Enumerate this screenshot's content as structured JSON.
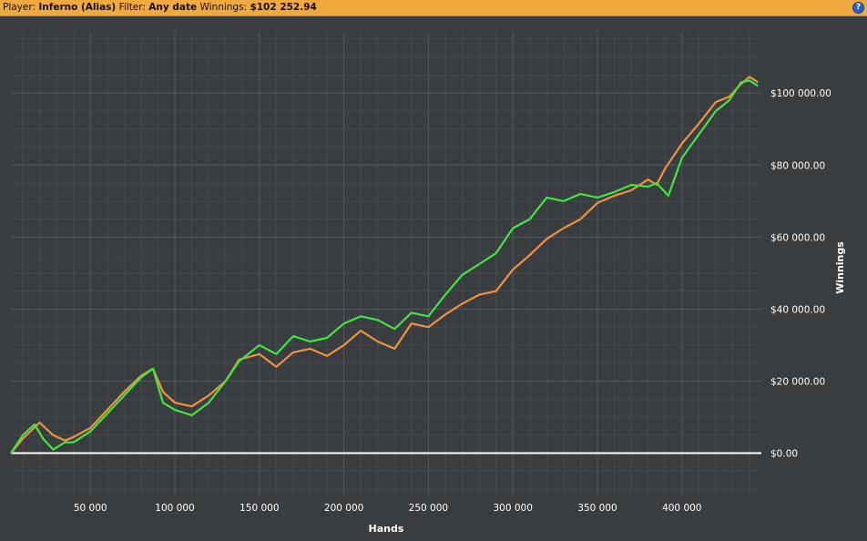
{
  "header": {
    "player_label": "Player:",
    "player_value": "Inferno (Alias)",
    "filter_label": "Filter:",
    "filter_value": "Any date",
    "winnings_label": "Winnings:",
    "winnings_value": "$102 252.94",
    "help_label": "?"
  },
  "colors": {
    "header_bg": "#f0a93f",
    "plot_bg": "#3a3d40",
    "grid": "#55595d",
    "series_green": "#3ee63e",
    "series_orange": "#f0913c",
    "zero_line": "#ffffff"
  },
  "chart_data": {
    "type": "line",
    "title": "",
    "xlabel": "Hands",
    "ylabel": "Winnings",
    "xlim": [
      3000,
      447000
    ],
    "ylim": [
      -12000,
      117000
    ],
    "x_ticks": [
      50000,
      100000,
      150000,
      200000,
      250000,
      300000,
      350000,
      400000
    ],
    "x_tick_labels": [
      "50 000",
      "100 000",
      "150 000",
      "200 000",
      "250 000",
      "300 000",
      "350 000",
      "400 000"
    ],
    "y_ticks": [
      0,
      20000,
      40000,
      60000,
      80000,
      100000
    ],
    "y_tick_labels": [
      "$0.00",
      "$20 000.00",
      "$40 000.00",
      "$60 000.00",
      "$80 000.00",
      "$100 000.00"
    ],
    "y_axis_side": "right",
    "grid": true,
    "legend": "none",
    "zero_line": true,
    "series": [
      {
        "color": "#f0913c",
        "x": [
          3000,
          10000,
          20000,
          28000,
          35000,
          40000,
          50000,
          60000,
          70000,
          80000,
          87000,
          93000,
          100000,
          110000,
          120000,
          130000,
          138000,
          150000,
          160000,
          170000,
          180000,
          190000,
          200000,
          210000,
          220000,
          230000,
          240000,
          250000,
          260000,
          270000,
          280000,
          290000,
          300000,
          310000,
          320000,
          330000,
          340000,
          350000,
          360000,
          370000,
          380000,
          385000,
          390000,
          400000,
          410000,
          420000,
          428000,
          435000,
          440000,
          445000
        ],
        "y": [
          0,
          4000,
          8500,
          5000,
          3500,
          4500,
          7000,
          12000,
          17000,
          21500,
          23500,
          17000,
          14000,
          13000,
          16000,
          20000,
          26000,
          27500,
          24000,
          28000,
          29000,
          27000,
          30000,
          34000,
          31000,
          29000,
          36000,
          35000,
          38500,
          41500,
          44000,
          45000,
          51000,
          55000,
          59500,
          62500,
          65000,
          69500,
          71500,
          73000,
          76000,
          74500,
          79000,
          86000,
          91500,
          97500,
          99000,
          102500,
          104500,
          103000
        ]
      },
      {
        "color": "#3ee63e",
        "x": [
          3000,
          10000,
          17000,
          22000,
          28000,
          35000,
          40000,
          50000,
          60000,
          70000,
          80000,
          87000,
          93000,
          100000,
          110000,
          120000,
          130000,
          138000,
          150000,
          160000,
          170000,
          180000,
          190000,
          200000,
          210000,
          220000,
          230000,
          240000,
          250000,
          260000,
          270000,
          280000,
          290000,
          300000,
          310000,
          320000,
          330000,
          340000,
          350000,
          360000,
          370000,
          380000,
          385000,
          392000,
          400000,
          410000,
          420000,
          428000,
          435000,
          440000,
          445000
        ],
        "y": [
          0,
          5000,
          8000,
          4000,
          1000,
          3000,
          3000,
          6000,
          11000,
          16000,
          21000,
          23500,
          14000,
          12000,
          10500,
          14000,
          20000,
          25500,
          30000,
          27500,
          32500,
          31000,
          32000,
          36000,
          38000,
          37000,
          34500,
          39000,
          38000,
          44000,
          49500,
          52500,
          55500,
          62500,
          65000,
          71000,
          70000,
          72000,
          71000,
          72500,
          74500,
          74000,
          75000,
          71500,
          82000,
          88500,
          95000,
          98000,
          103000,
          103500,
          102000
        ]
      }
    ]
  }
}
